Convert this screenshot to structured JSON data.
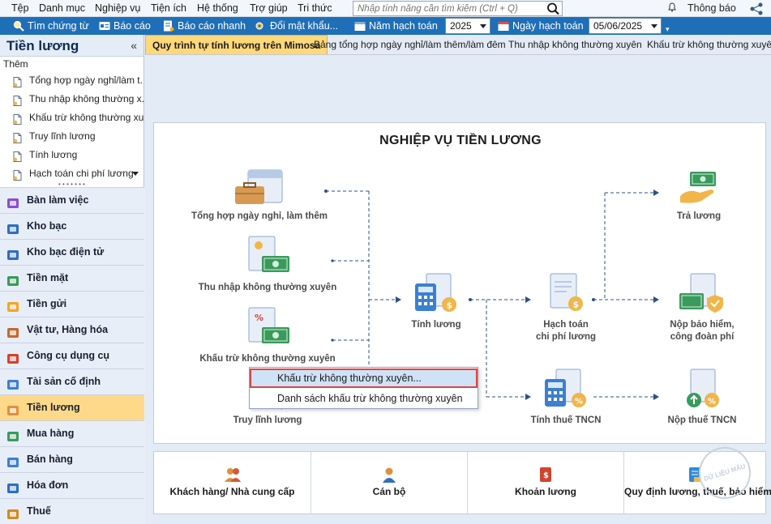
{
  "menu": [
    "Tệp",
    "Danh mục",
    "Nghiệp vụ",
    "Tiện ích",
    "Hệ thống",
    "Trợ giúp",
    "Tri thức"
  ],
  "search": {
    "placeholder": "Nhập tính năng cần tìm kiếm (Ctrl + Q)"
  },
  "notification": "Thông báo",
  "toolbar": {
    "find_voucher": "Tìm chứng từ",
    "report": "Báo cáo",
    "quick_report": "Báo cáo nhanh",
    "change_password": "Đổi mật khẩu...",
    "fiscal_year_label": "Năm hạch toán",
    "fiscal_year": "2025",
    "posting_date_label": "Ngày hạch toán",
    "posting_date": "05/06/2025"
  },
  "left_panel": {
    "title": "Tiền lương",
    "add_label": "Thêm",
    "sub_items": [
      "Tổng hợp ngày nghỉ/làm t...",
      "Thu nhập không thường x...",
      "Khấu trừ không thường xu...",
      "Truy lĩnh lương",
      "Tính lương",
      "Hạch toán chi phí lương"
    ],
    "modules": [
      "Bàn làm việc",
      "Kho bạc",
      "Kho bạc điện tử",
      "Tiền mặt",
      "Tiền gửi",
      "Vật tư, Hàng hóa",
      "Công cụ dụng cụ",
      "Tài sản cố định",
      "Tiền lương",
      "Mua hàng",
      "Bán hàng",
      "Hóa đơn",
      "Thuế"
    ],
    "active_module": "Tiền lương"
  },
  "tabs": [
    "Quy trình tự tính lương trên Mimosa",
    "Bảng tổng hợp ngày nghỉ/làm thêm/làm đêm",
    "Thu nhập không thường xuyên",
    "Khấu trừ không thường xuyên"
  ],
  "diagram": {
    "title": "NGHIỆP VỤ TIỀN LƯƠNG",
    "nodes": {
      "leave_summary": "Tổng hợp ngày nghỉ, làm thêm",
      "irregular_income": "Thu nhập không thường xuyên",
      "irregular_deduction": "Khấu trừ không thường xuyên",
      "back_pay": "Truy lĩnh lương",
      "calc_salary_l1": "Tính lương",
      "posting_l1": "Hạch toán",
      "posting_l2": "chi phí lương",
      "pay_salary": "Trả lương",
      "insurance_l1": "Nộp bảo hiểm,",
      "insurance_l2": "công đoàn phí",
      "pit_calc": "Tính thuế TNCN",
      "pit_pay": "Nộp thuế TNCN"
    }
  },
  "context_menu": {
    "items": [
      "Khấu trừ không thường xuyên...",
      "Danh sách khấu trừ không thường xuyên"
    ],
    "highlighted": 0
  },
  "shortcuts": [
    "Khách hàng/ Nhà cung cấp",
    "Cán bộ",
    "Khoản lương",
    "Quy định lương, thuế, bảo hiểm"
  ],
  "stamp_text": "DỮ LIỆU MẪU",
  "colors": {
    "toolbar": "#1f6fb8",
    "active_module": "#ffd98a",
    "active_tab": "#ffd87a",
    "highlight_border": "#e04343"
  }
}
